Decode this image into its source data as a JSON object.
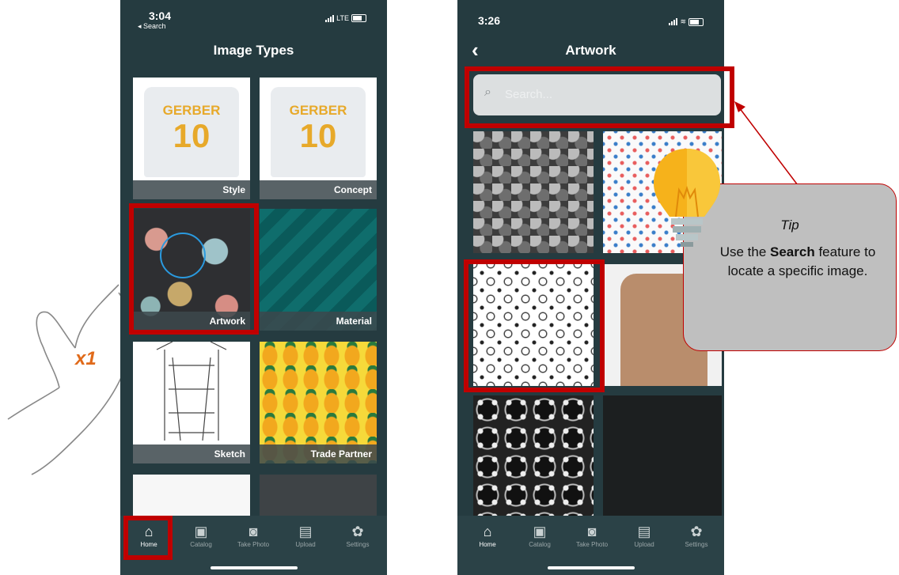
{
  "phone1": {
    "time": "3:04",
    "back_link": "◂ Search",
    "network": "LTE",
    "title": "Image Types",
    "tiles": [
      {
        "label": "Style",
        "jersey_text": "GERBER",
        "jersey_number": "10"
      },
      {
        "label": "Concept",
        "jersey_text": "GERBER",
        "jersey_number": "10"
      },
      {
        "label": "Artwork"
      },
      {
        "label": "Material"
      },
      {
        "label": "Sketch"
      },
      {
        "label": "Trade Partner"
      }
    ],
    "tabs": [
      {
        "label": "Home",
        "icon": "home-icon"
      },
      {
        "label": "Catalog",
        "icon": "image-icon"
      },
      {
        "label": "Take Photo",
        "icon": "camera-icon"
      },
      {
        "label": "Upload",
        "icon": "upload-icon"
      },
      {
        "label": "Settings",
        "icon": "gear-icon"
      }
    ]
  },
  "phone2": {
    "time": "3:26",
    "title": "Artwork",
    "search_placeholder": "Search...",
    "tabs": [
      {
        "label": "Home",
        "icon": "home-icon"
      },
      {
        "label": "Catalog",
        "icon": "image-icon"
      },
      {
        "label": "Take Photo",
        "icon": "camera-icon"
      },
      {
        "label": "Upload",
        "icon": "upload-icon"
      },
      {
        "label": "Settings",
        "icon": "gear-icon"
      }
    ]
  },
  "annotation": {
    "tap_count": "x1",
    "highlight_color": "#c00000",
    "tip_title": "Tip",
    "tip_prefix": "Use the ",
    "tip_bold": "Search",
    "tip_suffix": " feature to locate a specific image."
  }
}
